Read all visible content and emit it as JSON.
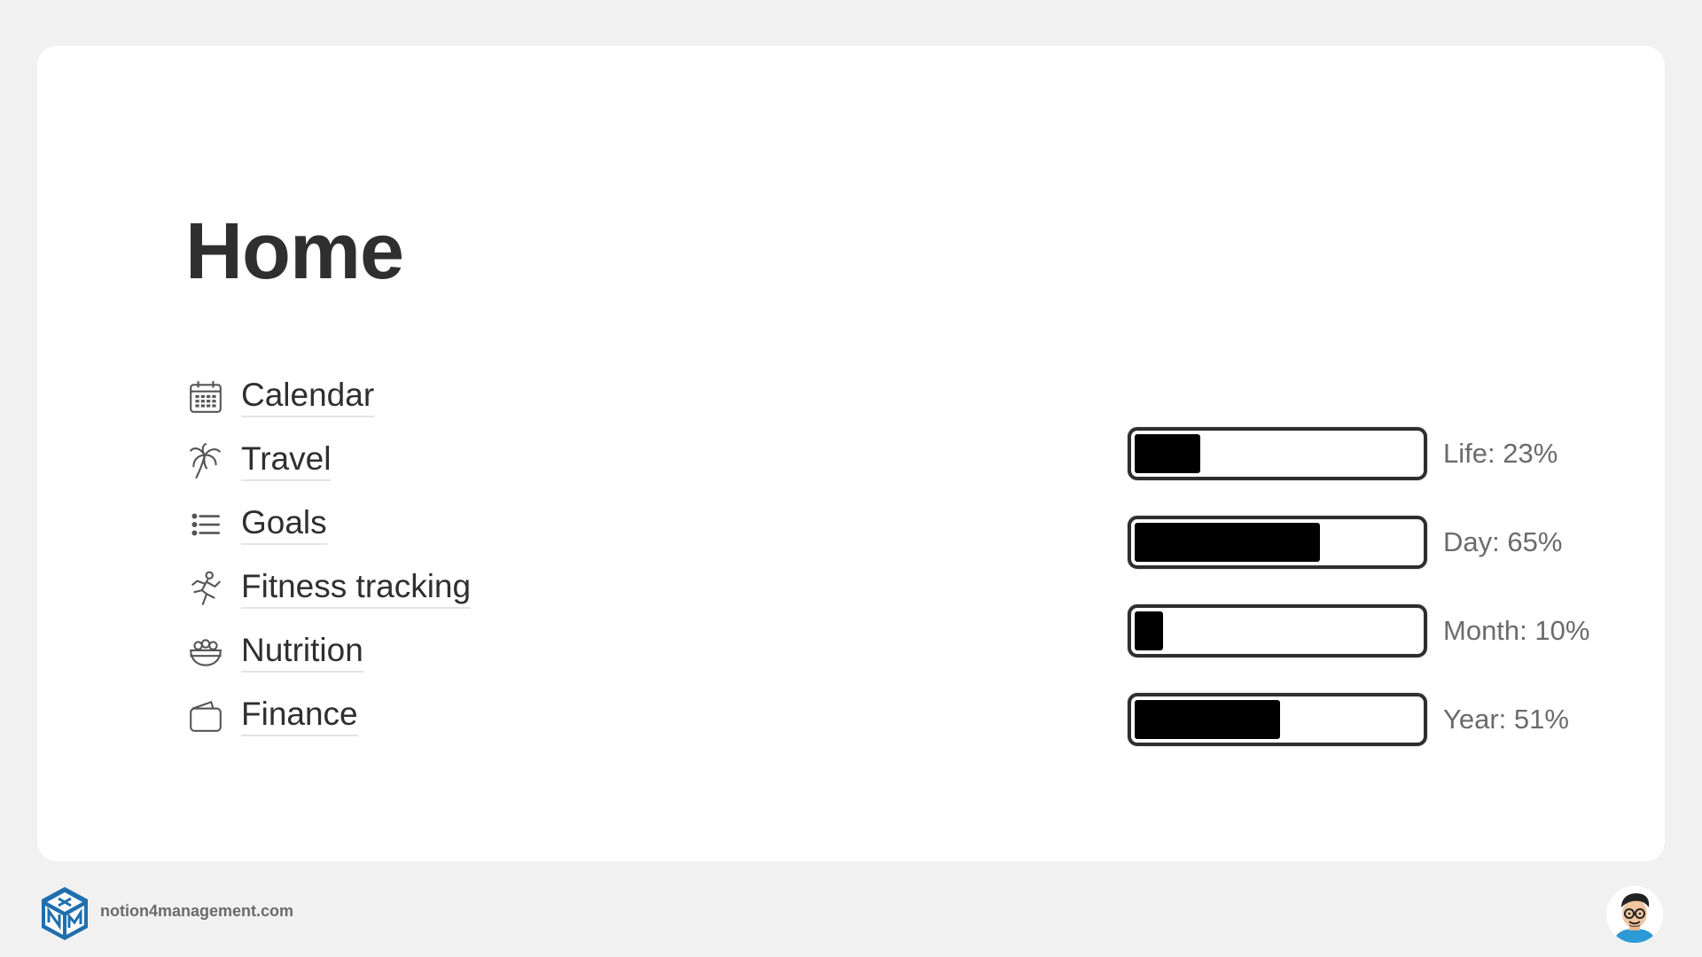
{
  "page": {
    "title": "Home"
  },
  "nav": {
    "items": [
      {
        "label": "Calendar",
        "icon": "calendar-icon"
      },
      {
        "label": "Travel",
        "icon": "palm-tree-icon"
      },
      {
        "label": "Goals",
        "icon": "bulleted-list-icon"
      },
      {
        "label": "Fitness tracking",
        "icon": "runner-icon"
      },
      {
        "label": "Nutrition",
        "icon": "salad-bowl-icon"
      },
      {
        "label": "Finance",
        "icon": "wallet-icon"
      }
    ]
  },
  "progress": [
    {
      "label": "Life: 23%",
      "value": 23
    },
    {
      "label": "Day: 65%",
      "value": 65
    },
    {
      "label": "Month: 10%",
      "value": 10
    },
    {
      "label": "Year: 51%",
      "value": 51
    }
  ],
  "footer": {
    "url": "notion4management.com",
    "logo_icon": "n4m-cube-logo",
    "avatar_icon": "avatar-illustration"
  },
  "colors": {
    "background": "#f1f1f1",
    "card": "#ffffff",
    "title": "#2f2f2f",
    "bar_fill": "#000000",
    "progress_label": "#6b6b6b",
    "logo_blue": "#1f6fae"
  }
}
